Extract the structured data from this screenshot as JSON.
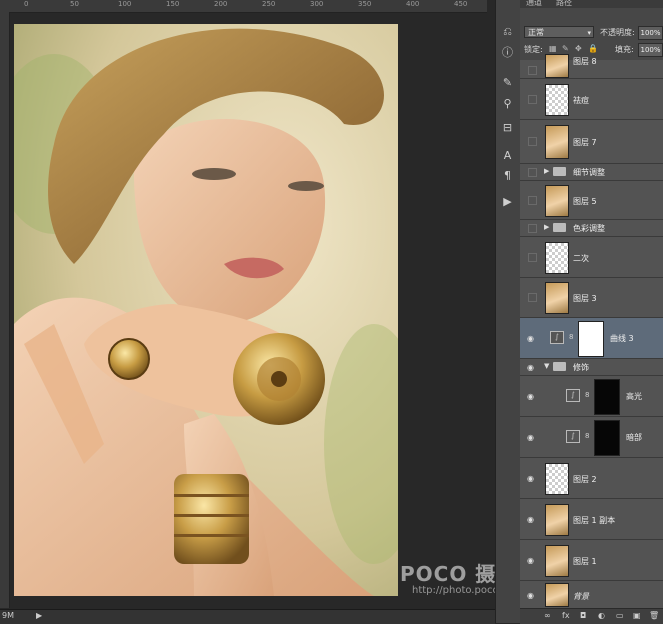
{
  "status": {
    "zoom": "9M",
    "play": "▶"
  },
  "ruler": {
    "ticks": [
      "0",
      "50",
      "100",
      "150",
      "200",
      "250",
      "300",
      "350",
      "400",
      "450"
    ]
  },
  "watermark": {
    "brand": "POCO 摄影专题",
    "url": "http://photo.poco.cn/"
  },
  "panel": {
    "tabs": [
      "通道",
      "路径"
    ],
    "blend_mode": "正常",
    "opacity_label": "不透明度:",
    "opacity_value": "100%",
    "lock_label": "锁定:",
    "fill_label": "填充:",
    "fill_value": "100%"
  },
  "layers": [
    {
      "name": "图层 8",
      "thumb": "photo",
      "visible": false
    },
    {
      "name": "祛痘",
      "thumb": "trans",
      "visible": false
    },
    {
      "name": "图层 7",
      "thumb": "photo",
      "visible": false
    },
    {
      "name": "细节调整",
      "thumb": "group",
      "visible": false
    },
    {
      "name": "图层 5",
      "thumb": "photo",
      "visible": false
    },
    {
      "name": "色彩调整",
      "thumb": "group",
      "visible": false
    },
    {
      "name": "二次",
      "thumb": "trans",
      "visible": false
    },
    {
      "name": "图层 3",
      "thumb": "photo",
      "visible": false
    },
    {
      "name": "曲线 3",
      "thumb": "curves",
      "visible": true,
      "selected": true
    },
    {
      "name": "修饰",
      "thumb": "group-open",
      "visible": true
    },
    {
      "name": "高光",
      "thumb": "curves-black",
      "visible": true
    },
    {
      "name": "暗部",
      "thumb": "curves-black",
      "visible": true
    },
    {
      "name": "图层 2",
      "thumb": "trans",
      "visible": true
    },
    {
      "name": "图层 1 副本",
      "thumb": "photo",
      "visible": true
    },
    {
      "name": "图层 1",
      "thumb": "photo",
      "visible": true
    },
    {
      "name": "背景",
      "thumb": "photo",
      "visible": true
    }
  ],
  "footer_icons": [
    "∞",
    "fx",
    "◘",
    "◐",
    "▭",
    "▣",
    "🗑"
  ]
}
